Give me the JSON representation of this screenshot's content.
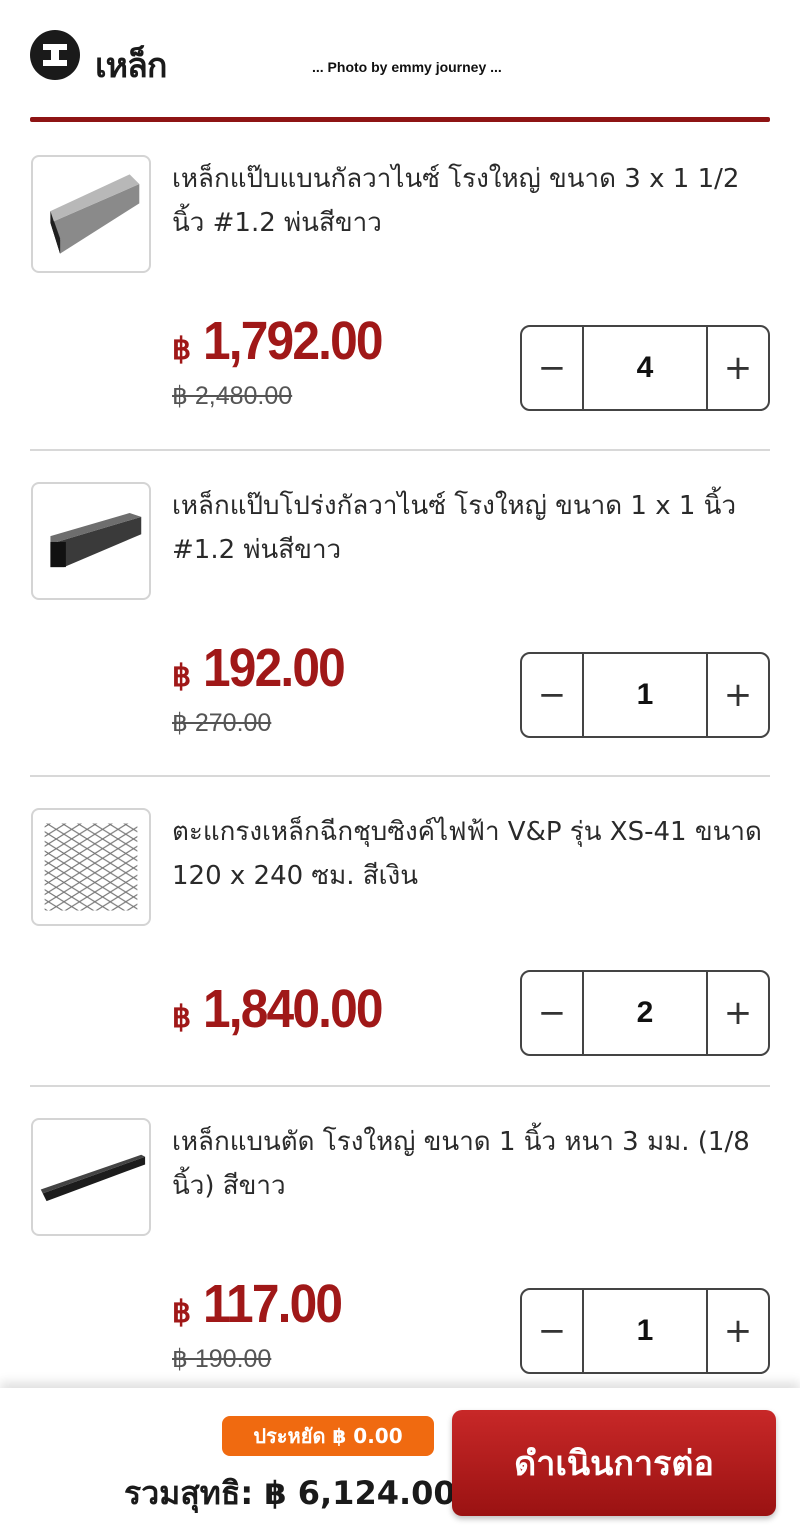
{
  "header": {
    "title": "เหล็ก",
    "icon": "steel-beam-icon",
    "photo_credit": "... Photo by emmy journey ...",
    "accent_color": "#8e1414"
  },
  "items": [
    {
      "name": "เหล็กแป๊บแบนกัลวาไนซ์ โรงใหญ่ ขนาด 3 x 1 1/2 นิ้ว #1.2 พ่นสีขาว",
      "currency": "฿",
      "price": "1,792.00",
      "old_price": "฿ 2,480.00",
      "quantity": "4",
      "image": "rectangular-tube-image"
    },
    {
      "name": "เหล็กแป๊บโปร่งกัลวาไนซ์ โรงใหญ่ ขนาด 1 x 1 นิ้ว #1.2 พ่นสีขาว",
      "currency": "฿",
      "price": "192.00",
      "old_price": "฿ 270.00",
      "quantity": "1",
      "image": "square-tube-image"
    },
    {
      "name": "ตะแกรงเหล็กฉีกชุบซิงค์ไฟฟ้า V&P รุ่น XS-41 ขนาด 120 x 240 ซม. สีเงิน",
      "currency": "฿",
      "price": "1,840.00",
      "old_price": "",
      "quantity": "2",
      "image": "expanded-metal-mesh-image"
    },
    {
      "name": "เหล็กแบนตัด โรงใหญ่ ขนาด 1 นิ้ว หนา 3 มม. (1/8 นิ้ว) สีขาว",
      "currency": "฿",
      "price": "117.00",
      "old_price": "฿ 190.00",
      "quantity": "1",
      "image": "flat-bar-image"
    }
  ],
  "stepper": {
    "minus": "−",
    "plus": "+"
  },
  "footer": {
    "savings": "ประหยัด ฿ 0.00",
    "total": "รวมสุทธิ: ฿ 6,124.00",
    "checkout_label": "ดำเนินการต่อ",
    "savings_color": "#f06a10",
    "checkout_color": "#b01c1c"
  }
}
